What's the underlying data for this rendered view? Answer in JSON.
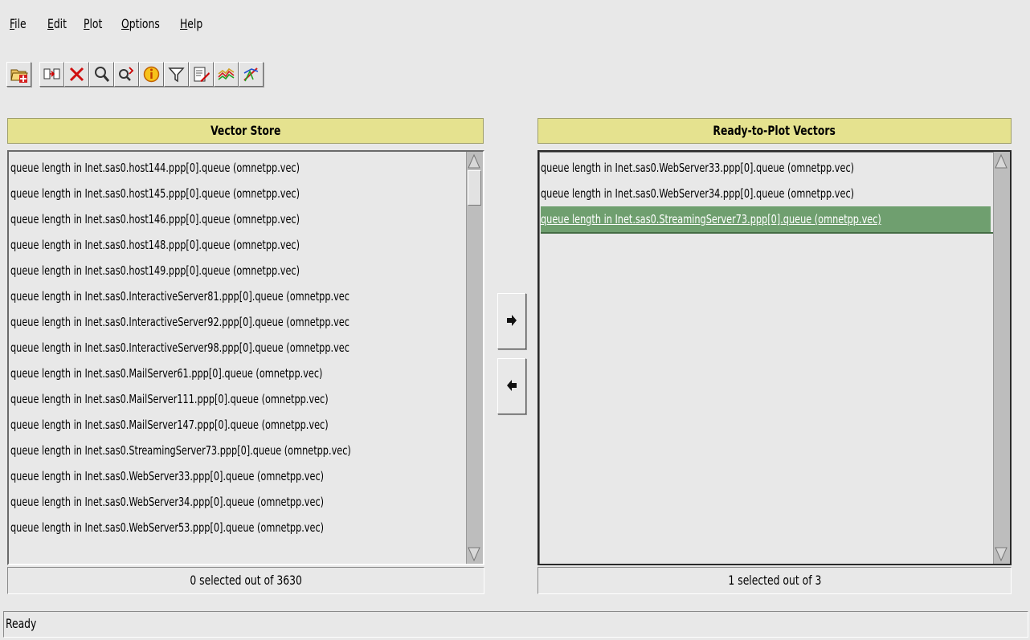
{
  "menu": [
    {
      "label": "File"
    },
    {
      "label": "Edit"
    },
    {
      "label": "Plot"
    },
    {
      "label": "Options"
    },
    {
      "label": "Help"
    }
  ],
  "toolbar": {
    "buttons": [
      {
        "icon": "open-file-icon"
      },
      {
        "icon": "copy-vector-icon"
      },
      {
        "icon": "delete-icon"
      },
      {
        "icon": "search-icon"
      },
      {
        "icon": "search-replace-icon"
      },
      {
        "icon": "info-icon"
      },
      {
        "icon": "filter-icon"
      },
      {
        "icon": "edit-note-icon"
      },
      {
        "icon": "plot-lines-icon"
      },
      {
        "icon": "plot-config-icon"
      }
    ]
  },
  "vector_store": {
    "title": "Vector Store",
    "items": [
      "queue length in Inet.sas0.host144.ppp[0].queue (omnetpp.vec)",
      "queue length in Inet.sas0.host145.ppp[0].queue (omnetpp.vec)",
      "queue length in Inet.sas0.host146.ppp[0].queue (omnetpp.vec)",
      "queue length in Inet.sas0.host148.ppp[0].queue (omnetpp.vec)",
      "queue length in Inet.sas0.host149.ppp[0].queue (omnetpp.vec)",
      "queue length in Inet.sas0.InteractiveServer81.ppp[0].queue (omnetpp.vec",
      "queue length in Inet.sas0.InteractiveServer92.ppp[0].queue (omnetpp.vec",
      "queue length in Inet.sas0.InteractiveServer98.ppp[0].queue (omnetpp.vec",
      "queue length in Inet.sas0.MailServer61.ppp[0].queue (omnetpp.vec)",
      "queue length in Inet.sas0.MailServer111.ppp[0].queue (omnetpp.vec)",
      "queue length in Inet.sas0.MailServer147.ppp[0].queue (omnetpp.vec)",
      "queue length in Inet.sas0.StreamingServer73.ppp[0].queue (omnetpp.vec)",
      "queue length in Inet.sas0.WebServer33.ppp[0].queue (omnetpp.vec)",
      "queue length in Inet.sas0.WebServer34.ppp[0].queue (omnetpp.vec)",
      "queue length in Inet.sas0.WebServer53.ppp[0].queue (omnetpp.vec)"
    ],
    "status": "0 selected out of 3630"
  },
  "ready_to_plot": {
    "title": "Ready-to-Plot Vectors",
    "items": [
      "queue length in Inet.sas0.WebServer33.ppp[0].queue (omnetpp.vec)",
      "queue length in Inet.sas0.WebServer34.ppp[0].queue (omnetpp.vec)",
      "queue length in Inet.sas0.StreamingServer73.ppp[0].queue (omnetpp.vec)"
    ],
    "selected_index": 2,
    "status": "1 selected out of 3"
  },
  "move_buttons": {
    "add_icon": "arrow-right-icon",
    "remove_icon": "arrow-left-icon"
  },
  "statusbar": {
    "text": "Ready"
  },
  "colors": {
    "header_bg": "#e5e28f",
    "selection_bg": "#6f9f6f",
    "window_bg": "#e8e8e8"
  }
}
